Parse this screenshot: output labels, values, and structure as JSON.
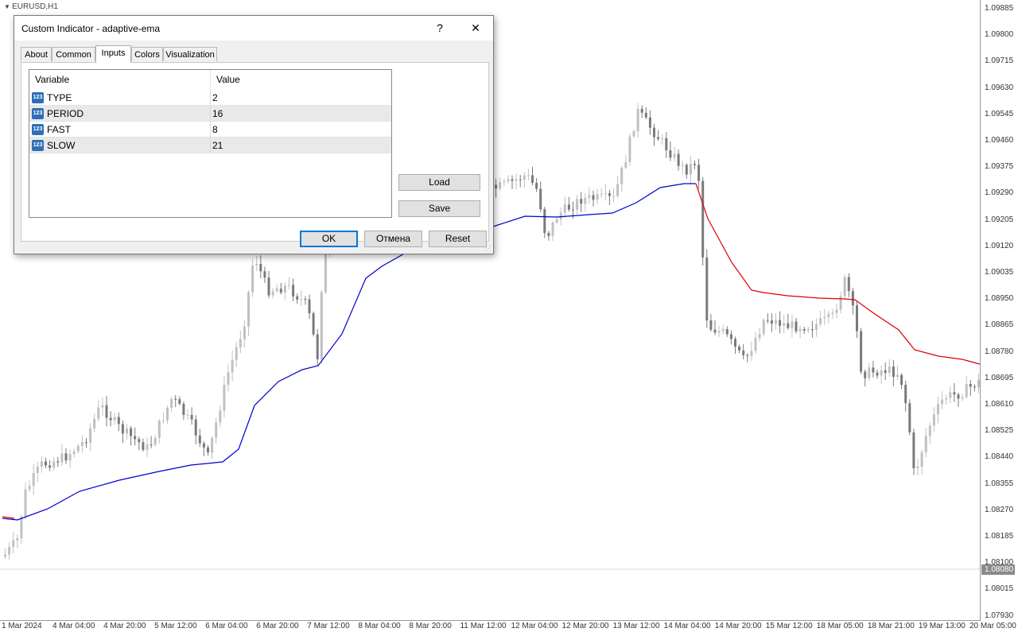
{
  "chart": {
    "symbol": "EURUSD,H1",
    "current_price": "1.08080",
    "price_labels": [
      "1.09885",
      "1.09800",
      "1.09715",
      "1.09630",
      "1.09545",
      "1.09460",
      "1.09375",
      "1.09290",
      "1.09205",
      "1.09120",
      "1.09035",
      "1.08950",
      "1.08865",
      "1.08780",
      "1.08695",
      "1.08610",
      "1.08525",
      "1.08440",
      "1.08355",
      "1.08270",
      "1.08185",
      "1.08100",
      "1.08015",
      "1.07930"
    ],
    "time_labels": [
      "1 Mar 2024",
      "4 Mar 04:00",
      "4 Mar 20:00",
      "5 Mar 12:00",
      "6 Mar 04:00",
      "6 Mar 20:00",
      "7 Mar 12:00",
      "8 Mar 04:00",
      "8 Mar 20:00",
      "11 Mar 12:00",
      "12 Mar 04:00",
      "12 Mar 20:00",
      "13 Mar 12:00",
      "14 Mar 04:00",
      "14 Mar 20:00",
      "15 Mar 12:00",
      "18 Mar 05:00",
      "18 Mar 21:00",
      "19 Mar 13:00",
      "20 Mar 05:00"
    ],
    "colors": {
      "bull": "#c0c0c0",
      "bear": "#7a7a7a",
      "ema_up": "#0000cc",
      "ema_down": "#dd0000",
      "grid": "#d8d8d8"
    }
  },
  "dialog": {
    "title": "Custom Indicator - adaptive-ema",
    "help_label": "?",
    "close_label": "✕",
    "tabs": [
      "About",
      "Common",
      "Inputs",
      "Colors",
      "Visualization"
    ],
    "active_tab": "Inputs",
    "columns": {
      "variable": "Variable",
      "value": "Value"
    },
    "icon_text": "123",
    "inputs": [
      {
        "name": "TYPE",
        "value": "2"
      },
      {
        "name": "PERIOD",
        "value": "16"
      },
      {
        "name": "FAST",
        "value": "8"
      },
      {
        "name": "SLOW",
        "value": "21"
      }
    ],
    "buttons": {
      "load": "Load",
      "save": "Save",
      "ok": "OK",
      "cancel": "Отмена",
      "reset": "Reset"
    }
  }
}
